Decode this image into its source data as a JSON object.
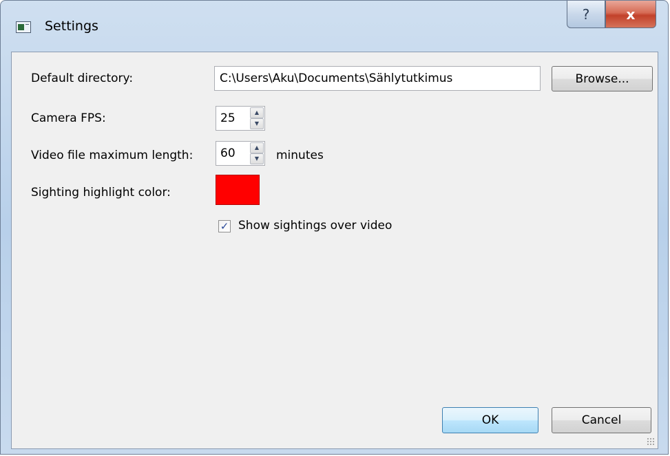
{
  "window": {
    "title": "Settings",
    "help_glyph": "?",
    "close_glyph": "x",
    "icon": "app-window-icon"
  },
  "form": {
    "default_directory": {
      "label": "Default directory:",
      "value": "C:\\Users\\Aku\\Documents\\Sählytutkimus",
      "browse_label": "Browse..."
    },
    "camera_fps": {
      "label": "Camera FPS:",
      "value": "25"
    },
    "video_max_length": {
      "label": "Video file maximum length:",
      "value": "60",
      "unit": "minutes"
    },
    "highlight_color": {
      "label": "Sighting highlight color:",
      "color": "#ff0000"
    },
    "show_sightings": {
      "label": "Show sightings over video",
      "checked": true,
      "check_glyph": "✓"
    }
  },
  "buttons": {
    "ok_label": "OK",
    "cancel_label": "Cancel"
  },
  "icons": {
    "spin_up": "▲",
    "spin_down": "▼"
  }
}
